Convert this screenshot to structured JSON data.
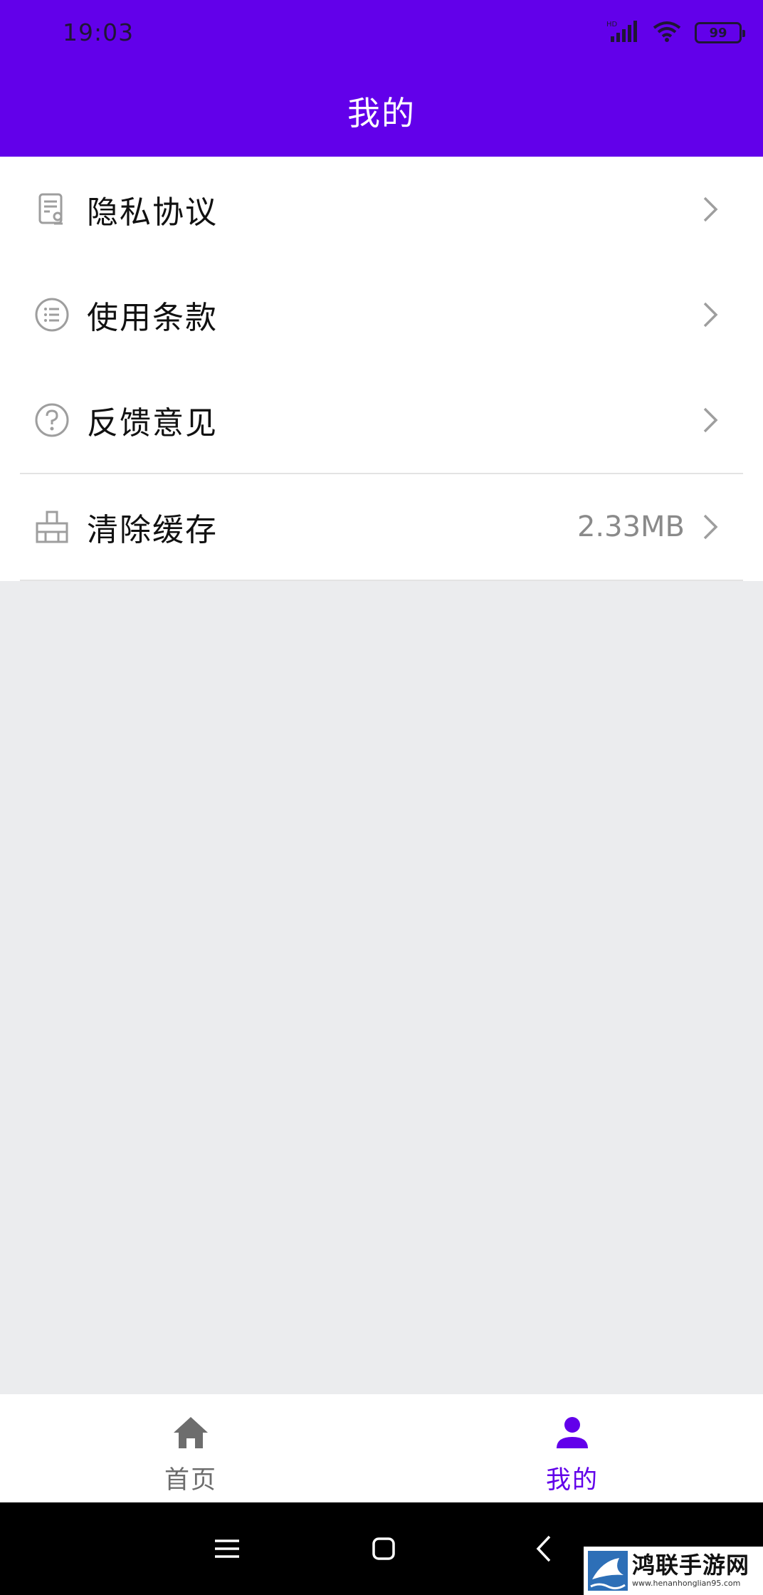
{
  "status_bar": {
    "time": "19:03",
    "network_label": "HD",
    "battery_level": "99",
    "icons": [
      "signal-icon",
      "wifi-icon",
      "battery-icon"
    ]
  },
  "header": {
    "title": "我的"
  },
  "menu": {
    "items": [
      {
        "label": "隐私协议",
        "icon": "privacy-document-icon",
        "value": ""
      },
      {
        "label": "使用条款",
        "icon": "list-icon",
        "value": ""
      },
      {
        "label": "反馈意见",
        "icon": "help-circle-icon",
        "value": ""
      },
      {
        "label": "清除缓存",
        "icon": "broom-icon",
        "value": "2.33MB"
      }
    ]
  },
  "bottom_nav": {
    "tabs": [
      {
        "label": "首页",
        "icon": "home-icon",
        "active": false
      },
      {
        "label": "我的",
        "icon": "person-icon",
        "active": true
      }
    ]
  },
  "system_nav": {
    "buttons": [
      "menu-icon",
      "home-square-icon",
      "back-icon"
    ]
  },
  "watermark": {
    "name": "鸿联手游网",
    "url": "www.henanhonglian95.com"
  },
  "colors": {
    "accent": "#6200EA",
    "background": "#EBECEE",
    "icon_gray": "#9E9E9E"
  }
}
